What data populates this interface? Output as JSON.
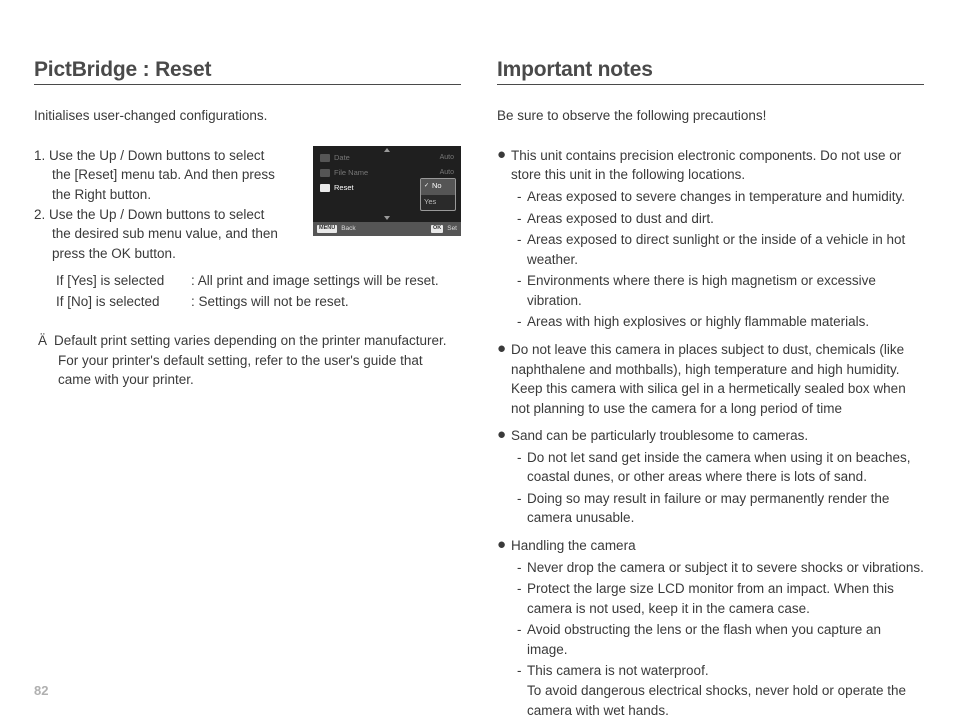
{
  "page_number": "82",
  "left": {
    "heading": "PictBridge : Reset",
    "intro": "Initialises user-changed configurations.",
    "steps": {
      "s1a": "1. Use the Up / Down buttons to select",
      "s1b": "the [Reset] menu tab. And then press",
      "s1c": "the Right button.",
      "s2a": "2. Use the Up / Down buttons to select",
      "s2b": "the desired sub menu value, and then",
      "s2c": "press the OK button."
    },
    "screen": {
      "rows": [
        {
          "label": "Date",
          "value": "Auto"
        },
        {
          "label": "File Name",
          "value": "Auto"
        },
        {
          "label": "Reset",
          "value": ""
        }
      ],
      "submenu": {
        "opt1": "No",
        "opt2": "Yes"
      },
      "footer": {
        "b1": "MENU",
        "t1": "Back",
        "b2": "OK",
        "t2": "Set"
      }
    },
    "defs": {
      "k1": "If [Yes] is selected",
      "v1": "All print and image settings will be reset.",
      "k2": "If [No] is selected",
      "v2": "Settings will not be reset."
    },
    "note": {
      "sym": "Ä",
      "l1": "Default print setting varies depending on the printer manufacturer.",
      "l2": "For your printer's default setting, refer to the user's guide that",
      "l3": "came with your printer."
    }
  },
  "right": {
    "heading": "Important notes",
    "intro": "Be sure to observe the following precautions!",
    "items": [
      {
        "text": "This unit contains precision electronic components. Do not use or store this unit in the following locations.",
        "subs": [
          "Areas exposed to severe changes in temperature and humidity.",
          "Areas exposed to dust and dirt.",
          "Areas exposed to direct sunlight or the inside of a vehicle in hot weather.",
          "Environments where there is high magnetism or excessive vibration.",
          "Areas with high explosives or highly flammable materials."
        ]
      },
      {
        "text": "Do not leave this camera in places subject to dust, chemicals (like naphthalene and mothballs), high temperature and high humidity. Keep this camera with silica gel in a hermetically sealed box when not planning to use the camera for a long period of time",
        "subs": []
      },
      {
        "text": "Sand can be particularly troublesome to cameras.",
        "subs": [
          "Do not let sand get inside the camera when using it on beaches, coastal dunes, or other areas where there is lots of sand.",
          "Doing so may result in failure or may permanently render the camera unusable."
        ]
      },
      {
        "text": "Handling the camera",
        "subs": [
          "Never drop the camera or subject it to severe shocks or vibrations.",
          "Protect  the large size LCD monitor from an impact. When this camera is not used, keep it in the camera case.",
          "Avoid obstructing the lens or the flash when you capture an image.",
          "This camera is not waterproof."
        ],
        "tail": "To avoid dangerous electrical shocks, never hold or operate the camera with wet hands."
      }
    ]
  }
}
